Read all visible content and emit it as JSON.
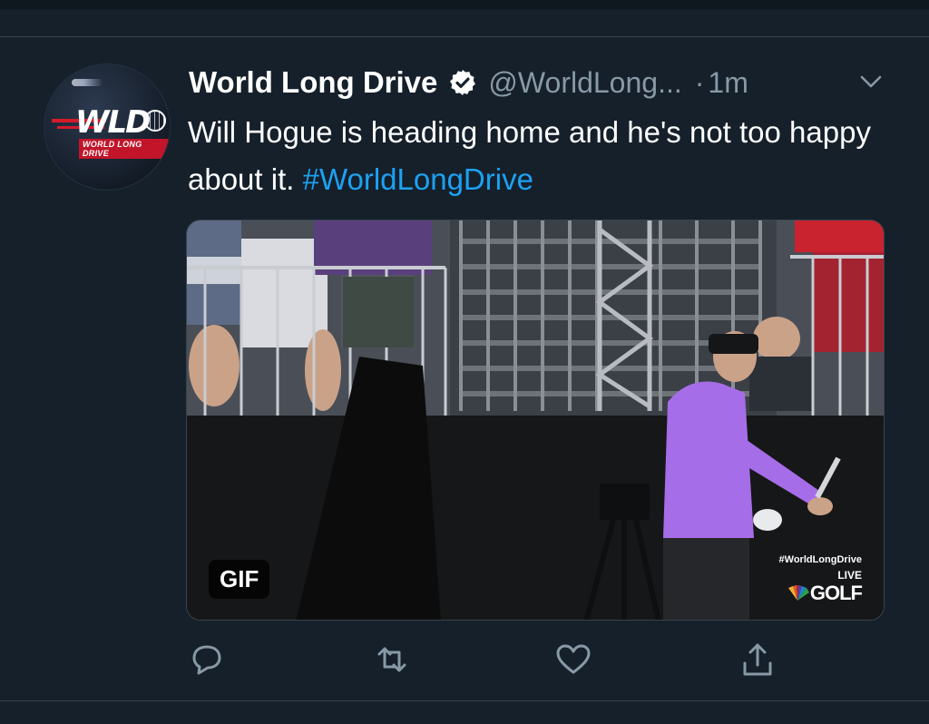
{
  "tweet": {
    "display_name": "World Long Drive",
    "handle": "@WorldLong...",
    "dot": "·",
    "time": "1m",
    "text_plain": "Will Hogue is heading home and he's not too happy about it. ",
    "hashtag": "#WorldLongDrive",
    "avatar_logo_text": "WLD",
    "avatar_sub_text": "WORLD LONG DRIVE"
  },
  "media": {
    "badge": "GIF",
    "watermark_tag": "#WorldLongDrive",
    "watermark_live": "LIVE",
    "watermark_network": "GOLF"
  },
  "icons": {
    "verified": "verified-badge-icon",
    "more": "chevron-down-icon",
    "reply": "reply-icon",
    "retweet": "retweet-icon",
    "like": "heart-icon",
    "share": "share-icon"
  },
  "colors": {
    "background": "#15202b",
    "text_secondary": "#8899a6",
    "link": "#1da1f2",
    "divider": "#38444d",
    "shirt": "#a66de8"
  }
}
